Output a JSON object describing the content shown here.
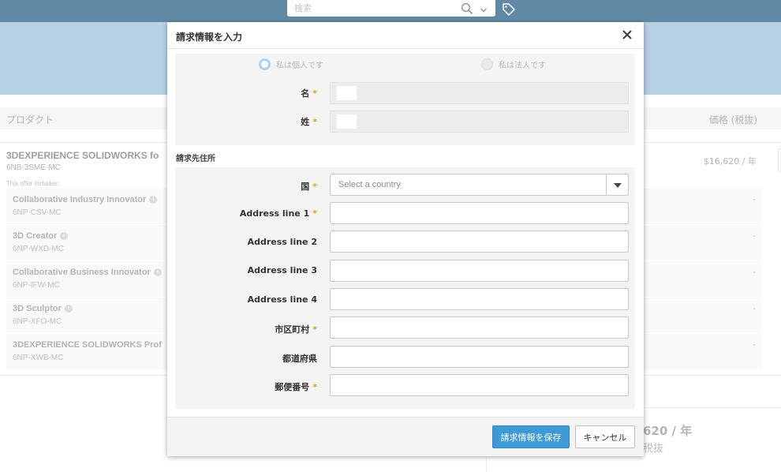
{
  "header": {
    "search_placeholder": "検索",
    "icons": [
      "search-icon",
      "chevron-down-icon",
      "tag-icon"
    ]
  },
  "background": {
    "columns": {
      "product": "プロダクト",
      "price": "価格 (税抜)"
    },
    "product": {
      "name": "3DEXPERIENCE SOLIDWORKS fo",
      "code": "6NB-3SME-MC",
      "price": "$16,620 / 年",
      "offer_note": "This offer includes:"
    },
    "included": [
      {
        "name": "Collaborative Industry Innovator",
        "code": "6NP-CSV-MC",
        "price": "-"
      },
      {
        "name": "3D Creator",
        "code": "6NP-WXD-MC",
        "price": "-"
      },
      {
        "name": "Collaborative Business Innovator",
        "code": "6NP-IFW-MC",
        "price": "-"
      },
      {
        "name": "3D Sculptor",
        "code": "6NP-XFO-MC",
        "price": "-"
      },
      {
        "name": "3DEXPERIENCE SOLIDWORKS Prof",
        "code": "6NP-XWB-MC",
        "price": "-"
      }
    ],
    "summary": {
      "amount": "620 / 年",
      "tax": "税抜"
    }
  },
  "modal": {
    "title": "請求情報を入力",
    "close_icon": "close-icon",
    "radio_individual": "私は個人です",
    "radio_corporate": "私は法人です",
    "first_name_label": "名",
    "last_name_label": "姓",
    "required_mark": "*",
    "billing_section": "請求先住所",
    "country_label": "国",
    "country_placeholder": "Select a country",
    "address1_label": "Address line 1",
    "address2_label": "Address line 2",
    "address3_label": "Address line 3",
    "address4_label": "Address line 4",
    "city_label": "市区町村",
    "prefecture_label": "都道府県",
    "postal_label": "郵便番号",
    "save_button": "請求情報を保存",
    "cancel_button": "キャンセル"
  },
  "colors": {
    "topbar": "#0d4a75",
    "hero": "#8fb7d6",
    "primary_button": "#3d9ad6",
    "required": "#e0a21b"
  }
}
